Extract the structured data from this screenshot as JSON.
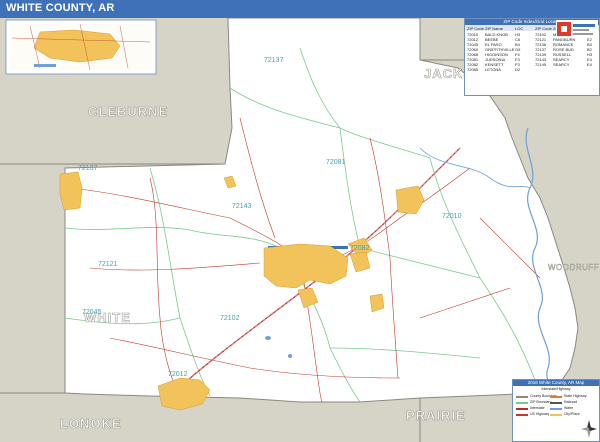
{
  "title": "WHITE COUNTY, AR",
  "map": {
    "neighbor_counties": [
      {
        "name": "CLEBURNE",
        "outside": true
      },
      {
        "name": "JACKSON",
        "outside": true
      },
      {
        "name": "PRAIRIE",
        "outside": true
      },
      {
        "name": "LONOKE",
        "outside": true
      },
      {
        "name": "WHITE",
        "outside": false
      },
      {
        "name": "WOODRUFF",
        "outside": true
      }
    ],
    "zip_codes": [
      "72137",
      "72143",
      "72102",
      "72045",
      "72012",
      "72081",
      "72121",
      "72060",
      "72082",
      "72010"
    ],
    "colors": {
      "background": "#ffffff",
      "outside_county": "#d6d3c7",
      "urban": "#f2c35b",
      "urban_edge": "#d89a2c",
      "zip_boundary": "#7cc98d",
      "road": "#c0392b",
      "highway": "#b52a2a",
      "water": "#6fa0d8",
      "county_border": "#8a8a80"
    }
  },
  "zip_table": {
    "heading": "ZIP Code Index/Grid Locator",
    "columns": [
      "ZIP Code",
      "ZIP Name",
      "LOC",
      "ZIP Code",
      "ZIP Name",
      "LOC"
    ],
    "rows": [
      [
        "72010",
        "BALD KNOB",
        "H3",
        "72102",
        "MC RAE",
        "D6"
      ],
      [
        "72012",
        "BEEBE",
        "C6",
        "72121",
        "PANGBURN",
        "E2"
      ],
      [
        "72045",
        "EL PASO",
        "B4",
        "72136",
        "ROMANCE",
        "B3"
      ],
      [
        "72060",
        "GRIFFITHVILLE",
        "G5",
        "72137",
        "ROSE BUD",
        "B2"
      ],
      [
        "72068",
        "HIGGINSON",
        "F4",
        "72139",
        "RUSSELL",
        "H3"
      ],
      [
        "72081",
        "JUDSONIA",
        "F3",
        "72143",
        "SEARCY",
        "E4"
      ],
      [
        "72082",
        "KENSETT",
        "F3",
        "72145",
        "SEARCY",
        "E4"
      ],
      [
        "72085",
        "LETONA",
        "D2",
        "",
        "",
        ""
      ]
    ]
  },
  "legend": {
    "heading": "2016 White County, AR Map",
    "subheading": "Interstate/Highway",
    "items": [
      {
        "label": "County Boundary",
        "color": "#8a8a80"
      },
      {
        "label": "ZIP Boundary",
        "color": "#7cc98d"
      },
      {
        "label": "Interstate",
        "color": "#b52a2a"
      },
      {
        "label": "US Highway",
        "color": "#c0392b"
      },
      {
        "label": "State Highway",
        "color": "#e07b39"
      },
      {
        "label": "Railroad",
        "color": "#555555"
      },
      {
        "label": "Water",
        "color": "#6fa0d8"
      },
      {
        "label": "City/Place",
        "color": "#f2c35b"
      }
    ]
  }
}
